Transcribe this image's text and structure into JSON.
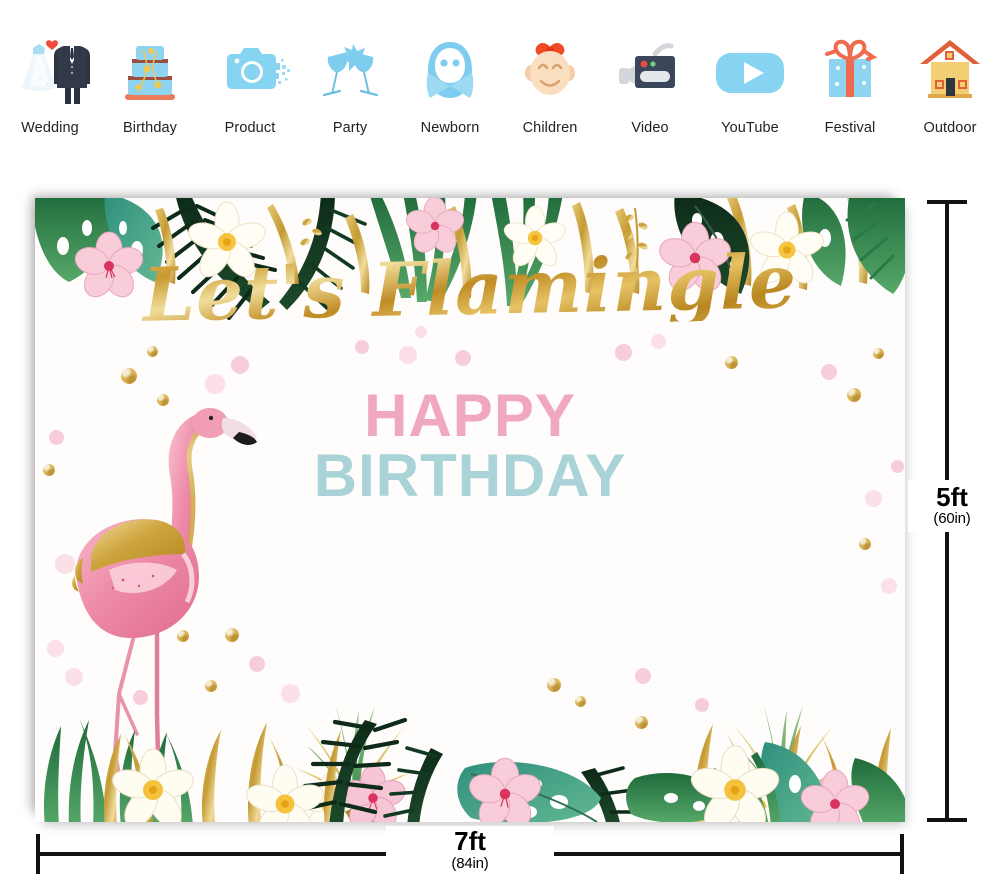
{
  "categories": [
    {
      "label": "Wedding",
      "icon": "wedding-dress-suit-icon"
    },
    {
      "label": "Birthday",
      "icon": "birthday-cake-icon"
    },
    {
      "label": "Product",
      "icon": "camera-icon"
    },
    {
      "label": "Party",
      "icon": "champagne-glasses-icon"
    },
    {
      "label": "Newborn",
      "icon": "swaddled-baby-icon"
    },
    {
      "label": "Children",
      "icon": "child-face-icon"
    },
    {
      "label": "Video",
      "icon": "video-camera-icon"
    },
    {
      "label": "YouTube",
      "icon": "youtube-play-icon"
    },
    {
      "label": "Festival",
      "icon": "gift-box-icon"
    },
    {
      "label": "Outdoor",
      "icon": "house-icon"
    }
  ],
  "backdrop": {
    "script_text": "Let's Flamingle",
    "line_happy": "HAPPY",
    "line_birthday": "BIRTHDAY",
    "theme": "tropical flamingo",
    "colors": {
      "gold": "#c9992f",
      "pink_text": "#f0a7c1",
      "blue_text": "#a9d3d6",
      "flamingo_pink": "#ef93ae",
      "leaf_green": "#2f7d46",
      "leaf_dark": "#12301e",
      "pineapple_gold": "#b8902c"
    }
  },
  "dimensions": {
    "height_ft": "5ft",
    "height_in": "(60in)",
    "width_ft": "7ft",
    "width_in": "(84in)"
  }
}
